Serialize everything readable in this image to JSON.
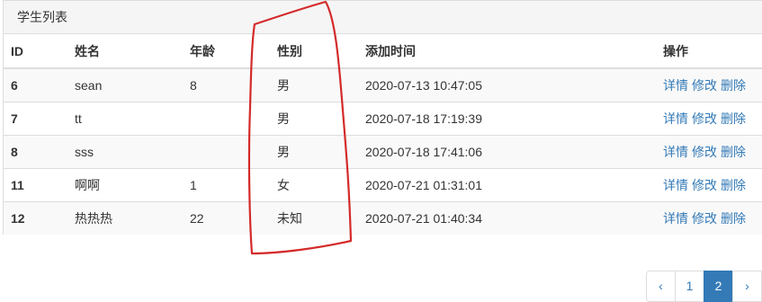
{
  "panel": {
    "title": "学生列表"
  },
  "table": {
    "headers": [
      "ID",
      "姓名",
      "年龄",
      "性别",
      "添加时间",
      "操作"
    ],
    "rows": [
      {
        "id": "6",
        "name": "sean",
        "age": "8",
        "gender": "男",
        "time": "2020-07-13 10:47:05"
      },
      {
        "id": "7",
        "name": "tt",
        "age": "",
        "gender": "男",
        "time": "2020-07-18 17:19:39"
      },
      {
        "id": "8",
        "name": "sss",
        "age": "",
        "gender": "男",
        "time": "2020-07-18 17:41:06"
      },
      {
        "id": "11",
        "name": "啊啊",
        "age": "1",
        "gender": "女",
        "time": "2020-07-21 01:31:01"
      },
      {
        "id": "12",
        "name": "热热热",
        "age": "22",
        "gender": "未知",
        "time": "2020-07-21 01:40:34"
      }
    ],
    "actions": {
      "detail": "详情",
      "edit": "修改",
      "delete": "删除"
    }
  },
  "pagination": {
    "prev": "‹",
    "pages": [
      "1",
      "2"
    ],
    "current": "2",
    "next": "›"
  },
  "annotation": {
    "color": "#d42a2a"
  }
}
